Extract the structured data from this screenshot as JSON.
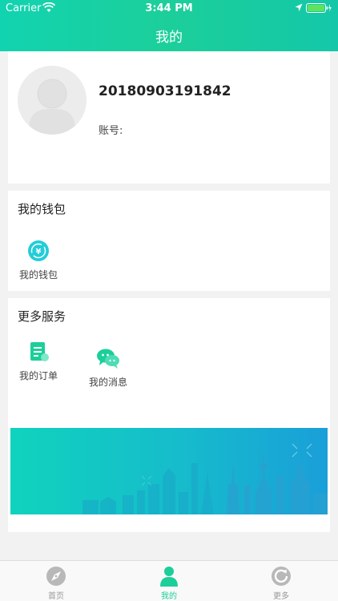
{
  "status_bar": {
    "carrier": "Carrier",
    "time": "3:44 PM"
  },
  "header": {
    "title": "我的"
  },
  "profile": {
    "username": "20180903191842",
    "account_label": "账号:"
  },
  "wallet": {
    "section_title": "我的钱包",
    "items": [
      {
        "label": "我的钱包",
        "icon": "wallet-icon"
      }
    ]
  },
  "services": {
    "section_title": "更多服务",
    "items": [
      {
        "label": "我的订单",
        "icon": "order-icon"
      },
      {
        "label": "我的消息",
        "icon": "message-icon"
      }
    ]
  },
  "tab_bar": {
    "tabs": [
      {
        "label": "首页",
        "icon": "compass-icon",
        "active": false
      },
      {
        "label": "我的",
        "icon": "person-icon",
        "active": true
      },
      {
        "label": "更多",
        "icon": "refresh-icon",
        "active": false
      }
    ]
  },
  "colors": {
    "accent": "#1ccf9a",
    "banner_start": "#12d3b8",
    "banner_end": "#1a9fd6"
  }
}
